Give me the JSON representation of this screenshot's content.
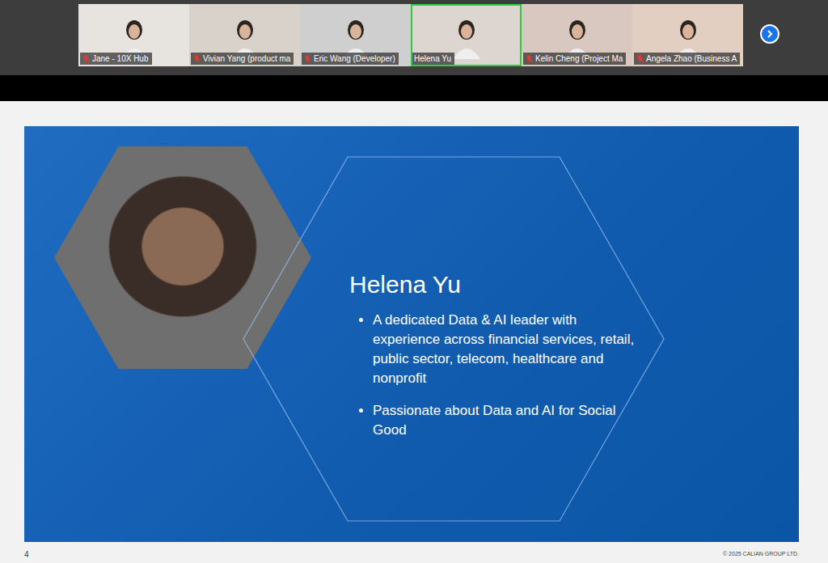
{
  "participants": [
    {
      "name": "Jane - 10X Hub",
      "muted": true,
      "selected": false
    },
    {
      "name": "Vivian Yang (product ma",
      "muted": true,
      "selected": false
    },
    {
      "name": "Eric Wang (Developer)",
      "muted": true,
      "selected": false
    },
    {
      "name": "Helena Yu",
      "muted": false,
      "selected": true
    },
    {
      "name": "Kelin Cheng (Project Ma",
      "muted": true,
      "selected": false
    },
    {
      "name": "Angela Zhao (Business A",
      "muted": true,
      "selected": false
    }
  ],
  "slide": {
    "name": "Helena Yu",
    "bullets": [
      "A dedicated Data & AI leader with experience across financial services, retail, public sector, telecom, healthcare and nonprofit",
      "Passionate about Data and AI for Social Good"
    ],
    "page_number": "4",
    "copyright": "© 2025 CALIAN GROUP LTD."
  }
}
